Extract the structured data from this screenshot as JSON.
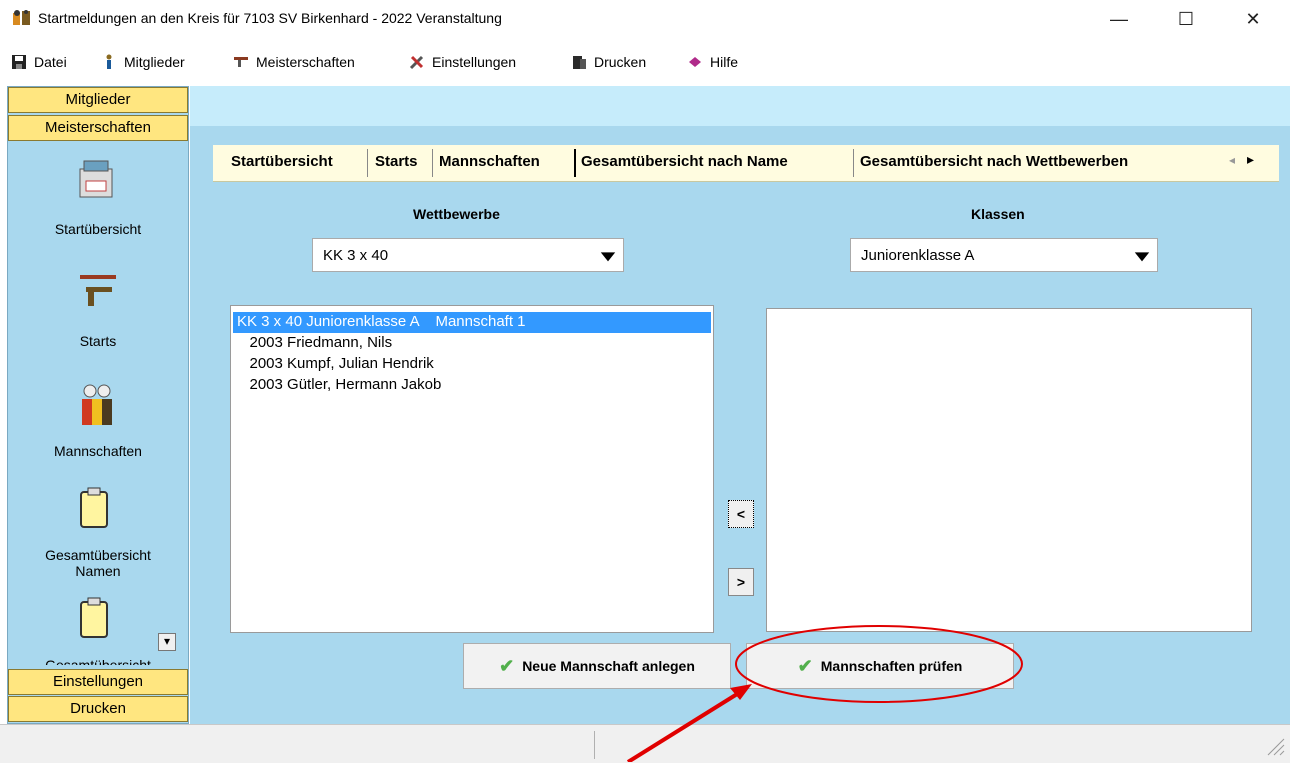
{
  "window": {
    "title": "Startmeldungen an den Kreis für 7103 SV Birkenhard - 2022  Veranstaltung",
    "minimize": "—",
    "maximize": "☐",
    "close": "✕"
  },
  "menu": [
    {
      "label": "Datei",
      "icon": "save-icon"
    },
    {
      "label": "Mitglieder",
      "icon": "person-icon"
    },
    {
      "label": "Meisterschaften",
      "icon": "gun-icon"
    },
    {
      "label": "Einstellungen",
      "icon": "tools-icon"
    },
    {
      "label": "Drucken",
      "icon": "printer-icon"
    },
    {
      "label": "Hilfe",
      "icon": "help-book-icon"
    }
  ],
  "sidebar": {
    "tabs_top": [
      "Mitglieder",
      "Meisterschaften"
    ],
    "items": [
      {
        "label": "Startübersicht",
        "icon": "cabinet-icon"
      },
      {
        "label": "Starts",
        "icon": "rifle-pistol-icon"
      },
      {
        "label": "Mannschaften",
        "icon": "team-icon"
      },
      {
        "label": "Gesamtübersicht\nNamen",
        "icon": "clipboard-icon"
      },
      {
        "label": "Gesamtübersicht",
        "icon": "clipboard-icon"
      }
    ],
    "scroll_down": "▾",
    "tabs_bottom": [
      "Einstellungen",
      "Drucken"
    ]
  },
  "tabs": [
    "Startübersicht",
    "Starts",
    "Mannschaften",
    "Gesamtübersicht nach Name",
    "Gesamtübersicht nach Wettbewerben"
  ],
  "tab_nav": {
    "prev": "◂",
    "next": "▸"
  },
  "wettbewerbe": {
    "label": "Wettbewerbe",
    "selected": "KK 3 x 40"
  },
  "klassen": {
    "label": "Klassen",
    "selected": "Juniorenklasse A"
  },
  "left_list": [
    "KK 3 x 40 Juniorenklasse A    Mannschaft 1",
    "   2003 Friedmann, Nils",
    "   2003 Kumpf, Julian Hendrik",
    "   2003 Gütler, Hermann Jakob"
  ],
  "move_left": "<",
  "move_right": ">",
  "buttons": {
    "new_team": "Neue Mannschaft anlegen",
    "check_teams": "Mannschaften prüfen"
  },
  "colors": {
    "accent_highlight": "#3399ff",
    "annotation": "#e00000",
    "sidebar_tab": "#ffe680",
    "panel": "#a9d8ee"
  }
}
